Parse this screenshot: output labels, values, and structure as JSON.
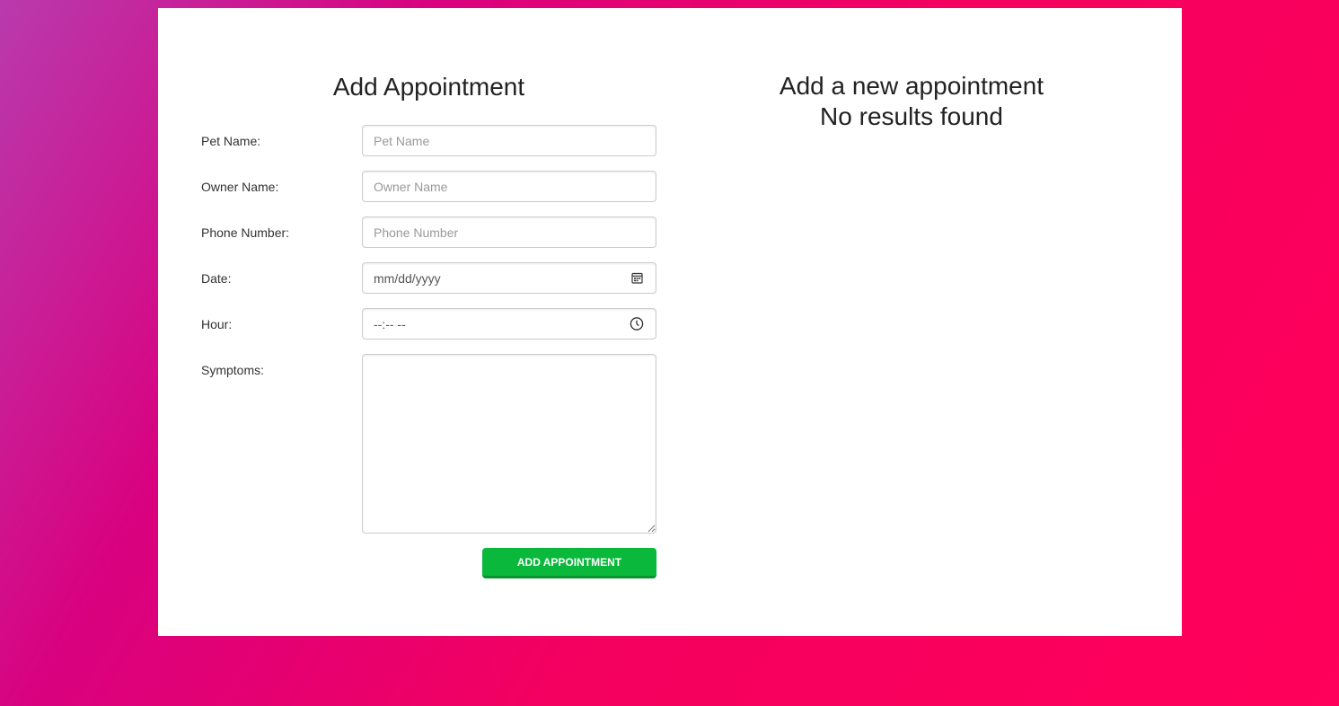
{
  "form": {
    "title": "Add Appointment",
    "fields": {
      "pet_name": {
        "label": "Pet Name:",
        "placeholder": "Pet Name"
      },
      "owner_name": {
        "label": "Owner Name:",
        "placeholder": "Owner Name"
      },
      "phone": {
        "label": "Phone Number:",
        "placeholder": "Phone Number"
      },
      "date": {
        "label": "Date:",
        "value": "mm/dd/yyyy"
      },
      "hour": {
        "label": "Hour:",
        "value": "--:-- --"
      },
      "symptoms": {
        "label": "Symptoms:"
      }
    },
    "submit_label": "ADD APPOINTMENT"
  },
  "results": {
    "title": "Add a new appointment",
    "empty_message": "No results found"
  },
  "colors": {
    "submit_button": "#0ab83c",
    "background_start": "#b93aad",
    "background_end": "#ff005a"
  },
  "icons": {
    "date": "calendar-icon",
    "hour": "clock-icon"
  }
}
